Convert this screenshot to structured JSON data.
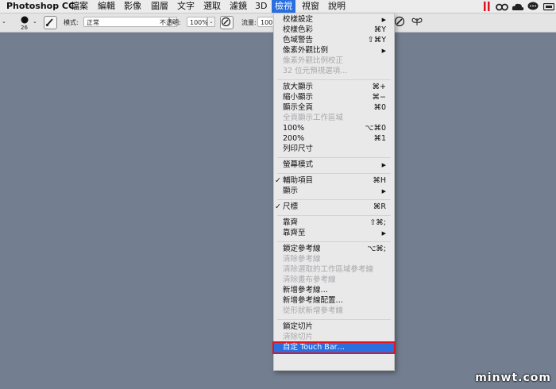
{
  "menubar": {
    "app": "Photoshop CC",
    "items": [
      "檔案",
      "編輯",
      "影像",
      "圖層",
      "文字",
      "選取",
      "濾鏡",
      "3D",
      "檢視",
      "視窗",
      "說明"
    ]
  },
  "status_icons": [
    "pause-bars-icon",
    "infinity-icon",
    "cloud-icon",
    "chat-bubble-icon",
    "display-icon"
  ],
  "options": {
    "brush_size": "26",
    "mode_label": "模式:",
    "mode_value": "正常",
    "opacity_label": "不透明:",
    "opacity_value": "100%",
    "flow_label": "流量:",
    "flow_value": "100"
  },
  "view_menu": {
    "items": [
      {
        "label": "校樣設定",
        "shortcut": "",
        "submenu": true,
        "disabled": false,
        "checked": false
      },
      {
        "label": "校樣色彩",
        "shortcut": "⌘Y",
        "submenu": false,
        "disabled": false,
        "checked": false
      },
      {
        "label": "色域警告",
        "shortcut": "⇧⌘Y",
        "submenu": false,
        "disabled": false,
        "checked": false
      },
      {
        "label": "像素外觀比例",
        "shortcut": "",
        "submenu": true,
        "disabled": false,
        "checked": false
      },
      {
        "label": "像素外觀比例校正",
        "shortcut": "",
        "submenu": false,
        "disabled": true,
        "checked": false
      },
      {
        "label": "32 位元預視選項…",
        "shortcut": "",
        "submenu": false,
        "disabled": true,
        "checked": false
      },
      {
        "sep": true
      },
      {
        "label": "放大顯示",
        "shortcut": "⌘+",
        "submenu": false,
        "disabled": false,
        "checked": false
      },
      {
        "label": "縮小顯示",
        "shortcut": "⌘−",
        "submenu": false,
        "disabled": false,
        "checked": false
      },
      {
        "label": "顯示全頁",
        "shortcut": "⌘0",
        "submenu": false,
        "disabled": false,
        "checked": false
      },
      {
        "label": "全頁顯示工作區域",
        "shortcut": "",
        "submenu": false,
        "disabled": true,
        "checked": false
      },
      {
        "label": "100%",
        "shortcut": "⌥⌘0",
        "submenu": false,
        "disabled": false,
        "checked": false
      },
      {
        "label": "200%",
        "shortcut": "⌘1",
        "submenu": false,
        "disabled": false,
        "checked": false
      },
      {
        "label": "列印尺寸",
        "shortcut": "",
        "submenu": false,
        "disabled": false,
        "checked": false
      },
      {
        "sep": true
      },
      {
        "label": "螢幕模式",
        "shortcut": "",
        "submenu": true,
        "disabled": false,
        "checked": false
      },
      {
        "sep": true
      },
      {
        "label": "輔助項目",
        "shortcut": "⌘H",
        "submenu": false,
        "disabled": false,
        "checked": true
      },
      {
        "label": "顯示",
        "shortcut": "",
        "submenu": true,
        "disabled": false,
        "checked": false
      },
      {
        "sep": true
      },
      {
        "label": "尺標",
        "shortcut": "⌘R",
        "submenu": false,
        "disabled": false,
        "checked": true
      },
      {
        "sep": true
      },
      {
        "label": "靠齊",
        "shortcut": "⇧⌘;",
        "submenu": false,
        "disabled": false,
        "checked": false
      },
      {
        "label": "靠齊至",
        "shortcut": "",
        "submenu": true,
        "disabled": false,
        "checked": false
      },
      {
        "sep": true
      },
      {
        "label": "鎖定參考線",
        "shortcut": "⌥⌘;",
        "submenu": false,
        "disabled": false,
        "checked": false
      },
      {
        "label": "清除參考線",
        "shortcut": "",
        "submenu": false,
        "disabled": true,
        "checked": false
      },
      {
        "label": "清除選取的工作區域參考線",
        "shortcut": "",
        "submenu": false,
        "disabled": true,
        "checked": false
      },
      {
        "label": "清除畫布參考線",
        "shortcut": "",
        "submenu": false,
        "disabled": true,
        "checked": false
      },
      {
        "label": "新增參考線…",
        "shortcut": "",
        "submenu": false,
        "disabled": false,
        "checked": false
      },
      {
        "label": "新增參考線配置…",
        "shortcut": "",
        "submenu": false,
        "disabled": false,
        "checked": false
      },
      {
        "label": "從形狀新增參考線",
        "shortcut": "",
        "submenu": false,
        "disabled": true,
        "checked": false
      },
      {
        "sep": true
      },
      {
        "label": "鎖定切片",
        "shortcut": "",
        "submenu": false,
        "disabled": false,
        "checked": false
      },
      {
        "label": "清除切片",
        "shortcut": "",
        "submenu": false,
        "disabled": true,
        "checked": false
      },
      {
        "label": "自定 Touch Bar…",
        "shortcut": "",
        "submenu": false,
        "disabled": false,
        "checked": false,
        "highlighted": true
      }
    ]
  },
  "colors": {
    "accent": "#2a6ee0",
    "canvas": "#737f91",
    "highlight_border": "#e0141e"
  },
  "watermark": "minwt.com"
}
